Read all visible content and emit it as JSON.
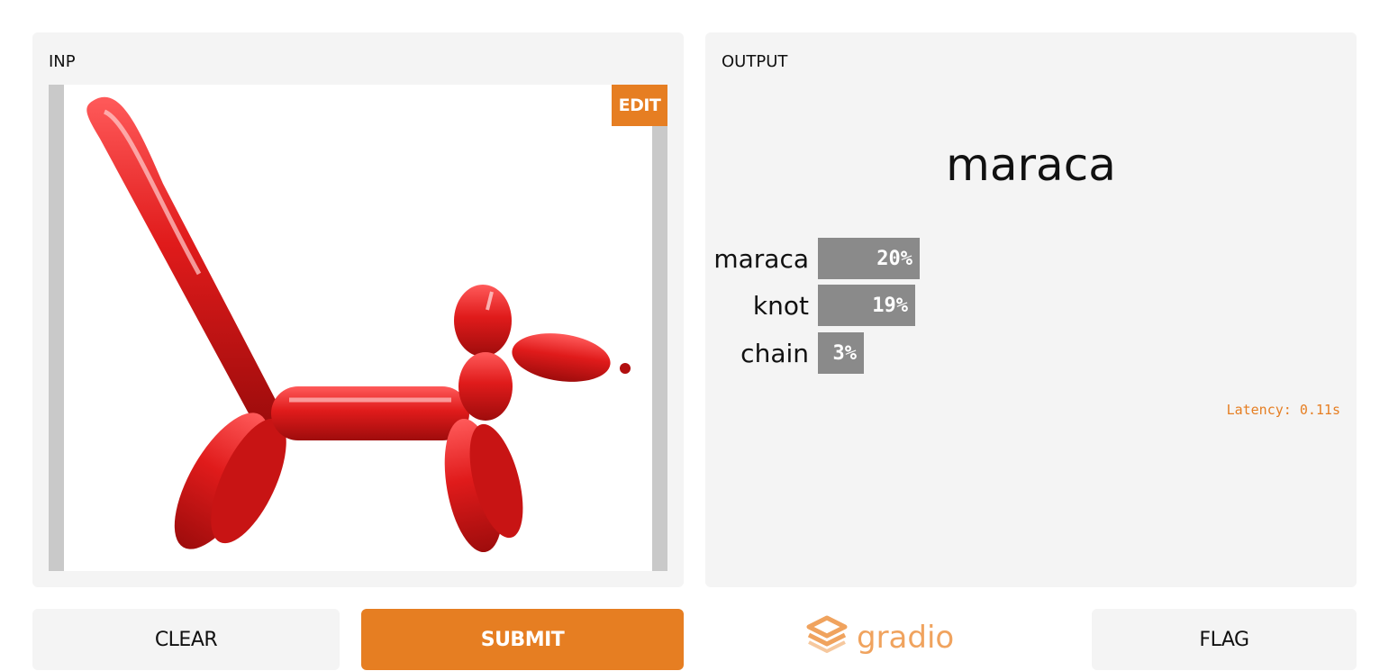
{
  "input": {
    "label": "INP",
    "edit_label": "EDIT",
    "image_description_icon": "balloon-dog-image"
  },
  "output": {
    "label": "OUTPUT",
    "top_prediction": "maraca",
    "confidences": [
      {
        "label": "maraca",
        "value": 0.2,
        "display": "20%"
      },
      {
        "label": "knot",
        "value": 0.19,
        "display": "19%"
      },
      {
        "label": "chain",
        "value": 0.03,
        "display": "3%"
      }
    ],
    "latency": "Latency: 0.11s"
  },
  "buttons": {
    "clear": "CLEAR",
    "submit": "SUBMIT",
    "flag": "FLAG"
  },
  "logo": {
    "text": "gradio",
    "icon": "gradio-logo-icon"
  },
  "colors": {
    "accent": "#e67e22",
    "panel_bg": "#f4f4f4",
    "bar": "#8a8a8a",
    "balloon": "#e01b1b"
  }
}
